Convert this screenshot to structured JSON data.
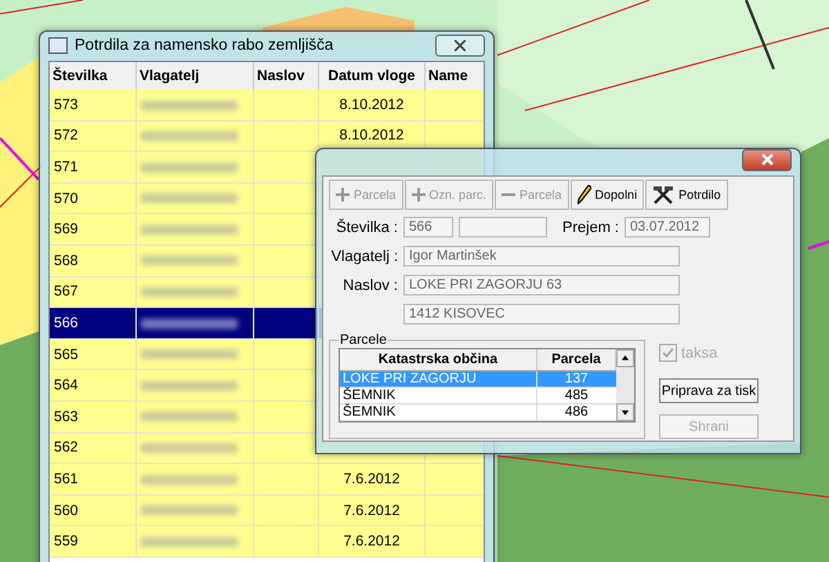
{
  "main_window": {
    "title": "Potrdila za namensko rabo zemljišča",
    "columns": [
      "Številka",
      "Vlagatelj",
      "Naslov",
      "Datum vloge",
      "Name"
    ],
    "rows": [
      {
        "number": "573",
        "date": "8.10.2012",
        "selected": false
      },
      {
        "number": "572",
        "date": "8.10.2012",
        "selected": false
      },
      {
        "number": "571",
        "selected": false
      },
      {
        "number": "570",
        "selected": false
      },
      {
        "number": "569",
        "selected": false
      },
      {
        "number": "568",
        "selected": false
      },
      {
        "number": "567",
        "selected": false
      },
      {
        "number": "566",
        "selected": true
      },
      {
        "number": "565",
        "selected": false
      },
      {
        "number": "564",
        "selected": false
      },
      {
        "number": "563",
        "selected": false
      },
      {
        "number": "562",
        "selected": false
      },
      {
        "number": "561",
        "date": "7.6.2012",
        "selected": false
      },
      {
        "number": "560",
        "date": "7.6.2012",
        "selected": false
      },
      {
        "number": "559",
        "date": "7.6.2012",
        "selected": false
      }
    ]
  },
  "dialog": {
    "toolbar": [
      {
        "label": "Parcela",
        "kind": "plus",
        "disabled": true
      },
      {
        "label": "Ozn. parc.",
        "kind": "plus",
        "disabled": true
      },
      {
        "label": "Parcela",
        "kind": "minus",
        "disabled": true
      },
      {
        "label": "Dopolni",
        "kind": "pencil",
        "disabled": false
      },
      {
        "label": "Potrdilo",
        "kind": "tools",
        "disabled": false
      }
    ],
    "number": {
      "label": "Številka :",
      "value": "566"
    },
    "received": {
      "label": "Prejem :",
      "value": "03.07.2012"
    },
    "applicant": {
      "label": "Vlagatelj :",
      "value": "Igor Martinšek"
    },
    "address": {
      "label": "Naslov :",
      "value": "LOKE PRI ZAGORJU 63",
      "value_2": "1412 KISOVEC"
    },
    "parcels": {
      "title": "Parcele",
      "columns": [
        "Katastrska občina",
        "Parcela"
      ],
      "rows": [
        {
          "municipality": "LOKE PRI ZAGORJU",
          "parcel": "137",
          "selected": true
        },
        {
          "municipality": "ŠEMNIK",
          "parcel": "485",
          "selected": false
        },
        {
          "municipality": "ŠEMNIK",
          "parcel": "486",
          "selected": false
        }
      ]
    },
    "checkbox": {
      "label": "taksa",
      "checked": true,
      "disabled": true
    },
    "buttons": [
      {
        "label": "Priprava za tisk",
        "disabled": false
      },
      {
        "label": "Shrani",
        "disabled": true
      }
    ]
  }
}
